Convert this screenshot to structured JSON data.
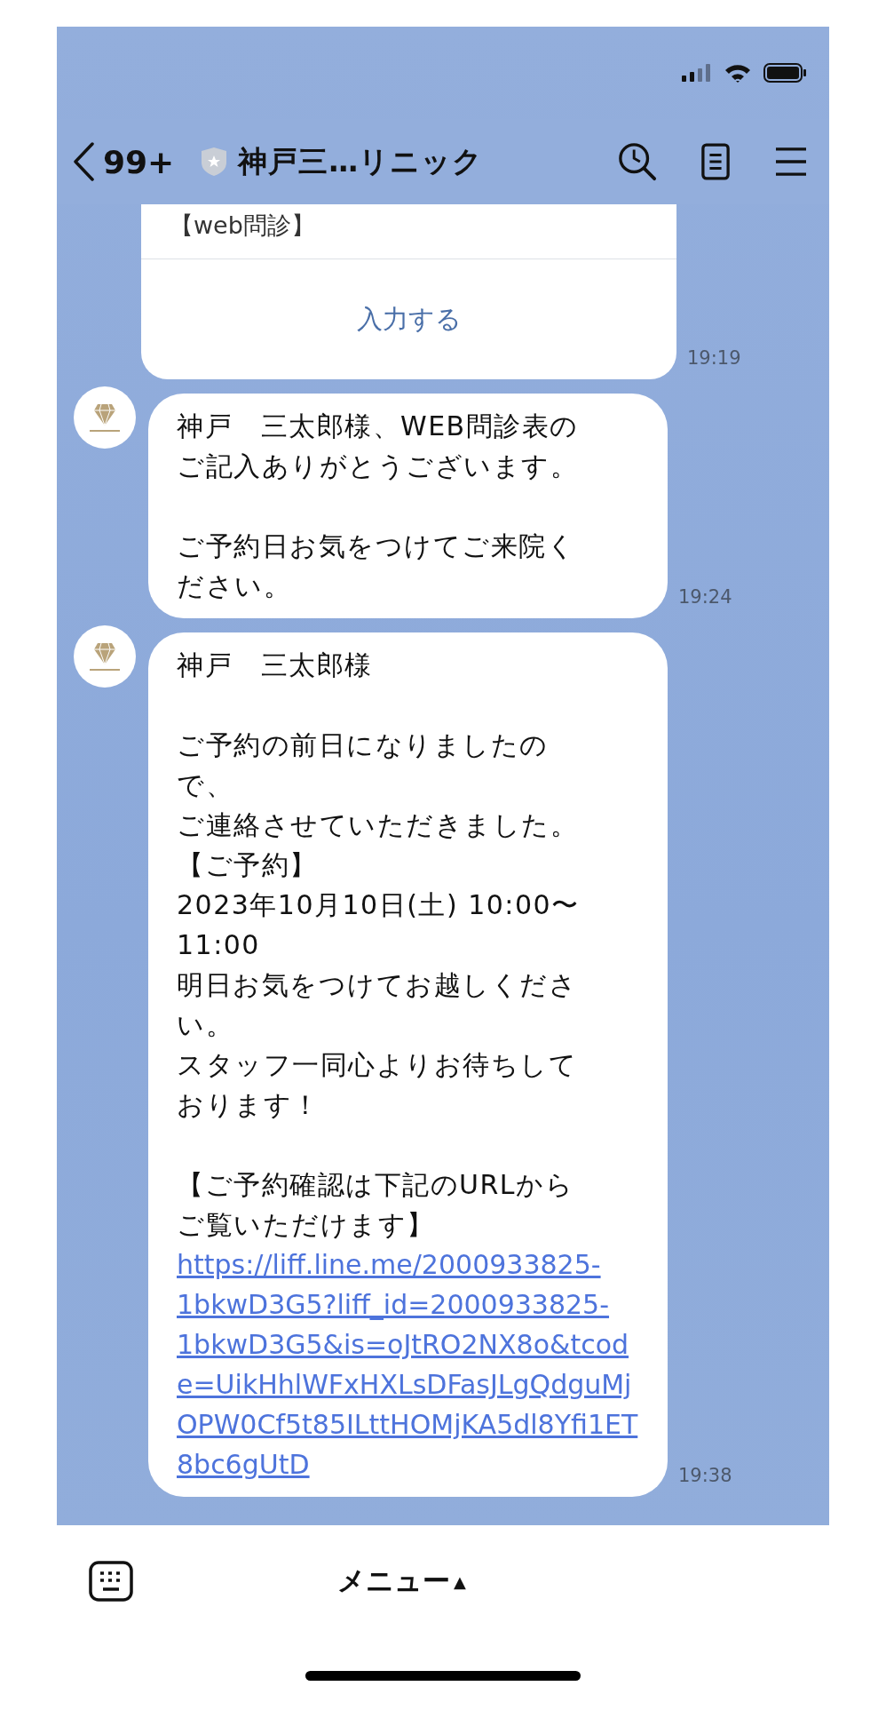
{
  "header": {
    "unread_count": "99+",
    "title": "神戸三…リニック"
  },
  "messages": [
    {
      "kind": "card",
      "title": "【web問診】",
      "action": "入力する",
      "time": "19:19"
    },
    {
      "kind": "text",
      "paragraphs": [
        {
          "lines": [
            "神戸　三太郎様、WEB問診表のご記入ありがとうございます。"
          ]
        },
        {
          "lines": [
            "ご予約日お気をつけてご来院ください。"
          ]
        }
      ],
      "time": "19:24"
    },
    {
      "kind": "text",
      "paragraphs": [
        {
          "lines": [
            "神戸　三太郎様"
          ]
        },
        {
          "lines": [
            "ご予約の前日になりましたので、",
            "ご連絡させていただきました。",
            "【ご予約】",
            "2023年10月10日(土) 10:00〜11:00",
            "明日お気をつけてお越しください。",
            "スタッフ一同心よりお待ちしております！"
          ]
        },
        {
          "lines": [
            "【ご予約確認は下記のURLからご覧いただけます】"
          ]
        }
      ],
      "link": "https://liff.line.me/2000933825-1bkwD3G5?liff_id=2000933825-1bkwD3G5&is=oJtRO2NX8o&tcode=UikHhlWFxHXLsDFasJLgQdguMjOPW0Cf5t85ILttHOMjKA5dl8Yfi1ET8bc6gUtD",
      "time": "19:38"
    }
  ],
  "bottom_bar": {
    "menu_label": "メニュー",
    "menu_indicator": "▲"
  }
}
